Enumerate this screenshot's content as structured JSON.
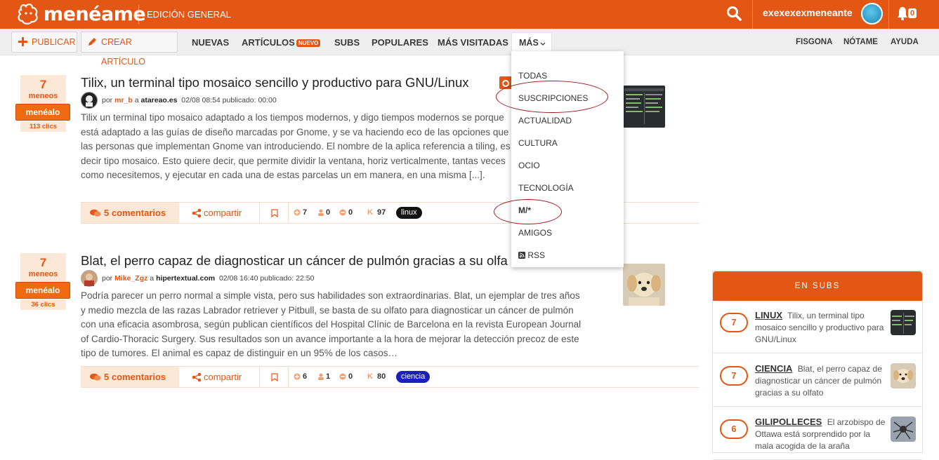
{
  "header": {
    "logo_text": "menéame",
    "edition": "EDICIÓN GENERAL",
    "username": "exexexexmeneante",
    "notifications_count": "0",
    "accent": "#e35614"
  },
  "nav": {
    "publish_label": "PUBLICAR",
    "create_article_label": "CREAR ARTÍCULO",
    "nuevas": "NUEVAS",
    "articulos": "ARTÍCULOS",
    "nuevo_badge": "NUEVO",
    "subs": "SUBS",
    "populares": "POPULARES",
    "mas_visitadas": "MÁS VISITADAS",
    "mas": "MÁS",
    "fisgona": "FISGONA",
    "notame": "NÓTAME",
    "ayuda": "AYUDA"
  },
  "dropdown": {
    "items": [
      "TODAS",
      "SUSCRIPCIONES",
      "ACTUALIDAD",
      "CULTURA",
      "OCIO",
      "TECNOLOGÍA",
      "M/*",
      "AMIGOS",
      "RSS"
    ]
  },
  "stories": [
    {
      "votes": "7",
      "votes_label": "meneos",
      "menealo": "menéalo",
      "clics": "113 clics",
      "title": "Tilix, un terminal tipo mosaico sencillo y productivo para GNU/Linux",
      "por": "por",
      "user": "mr_b",
      "a": "a",
      "site": "atareao.es",
      "date": "02/08 08:54 publicado: 00:00",
      "text": "Tilix un terminal tipo mosaico adaptado a los tiempos modernos, y digo tiempos modernos se porque está adaptado a las guías de diseño marcadas por Gnome, y se va haciendo eco de las opciones que las personas que implementan Gnome van introduciendo. El nombre de la aplica referencia a tiling, es decir tipo mosaico. Esto quiere decir, que permite dividir la ventana, horiz verticalmente, tantas veces como necesitemos, y ejecutar en cada una de estas parcelas un em manera, en una misma [...].",
      "comments": "5 comentarios",
      "share": "compartir",
      "positive": "7",
      "anonymous": "0",
      "negative": "0",
      "karma": "97",
      "tag": "linux",
      "tag_color": "#111111"
    },
    {
      "votes": "7",
      "votes_label": "meneos",
      "menealo": "menéalo",
      "clics": "36 clics",
      "title": "Blat, el perro capaz de diagnosticar un cáncer de pulmón gracias a su olfa",
      "por": "por",
      "user": "Mike_Zgz",
      "a": "a",
      "site": "hipertextual.com",
      "date": "02/08 16:40 publicado: 22:50",
      "text": "Podría parecer un perro normal a simple vista, pero sus habilidades son extraordinarias. Blat, un ejemplar de tres años y medio mezcla de las razas Labrador retriever y Pitbull, se basta de su olfato para diagnosticar un cáncer de pulmón con una eficacia asombrosa, según publican científicos del Hospital Clínic de Barcelona en la revista European Journal of Cardio-Thoracic Surgery. Sus resultados son un avance importante a la hora de mejorar la detección precoz de este tipo de tumores. El animal es capaz de distinguir en un 95% de los casos…",
      "comments": "5 comentarios",
      "share": "compartir",
      "positive": "6",
      "anonymous": "1",
      "negative": "0",
      "karma": "80",
      "tag": "ciencia",
      "tag_color": "#1c20b8"
    }
  ],
  "sidebar": {
    "title": "EN SUBS",
    "items": [
      {
        "votes": "7",
        "sub": "LINUX",
        "text": "Tilix, un terminal tipo mosaico sencillo y productivo para GNU/Linux"
      },
      {
        "votes": "7",
        "sub": "CIENCIA",
        "text": "Blat, el perro capaz de diagnosticar un cáncer de pulmón gracias a su olfato"
      },
      {
        "votes": "6",
        "sub": "GILIPOLLECES",
        "text": "El arzobispo de Ottawa está sorprendido por la mala acogida de la araña"
      }
    ]
  }
}
